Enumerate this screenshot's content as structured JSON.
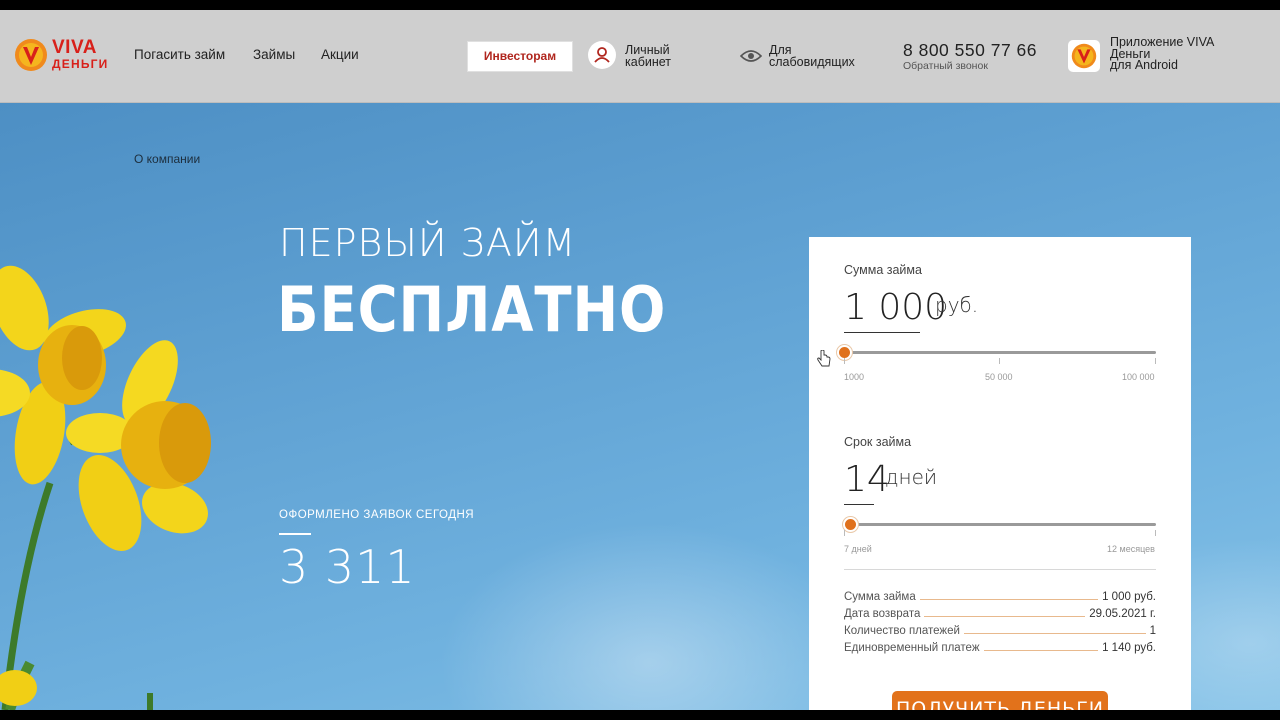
{
  "header": {
    "logo": {
      "brand_line1": "VIVA",
      "brand_line2": "ДЕНЬГИ"
    },
    "nav": [
      {
        "label": "Погасить займ"
      },
      {
        "label": "Займы"
      },
      {
        "label": "Акции"
      }
    ],
    "investors_button": "Инвесторам",
    "cabinet": {
      "line1": "Личный",
      "line2": "кабинет",
      "icon": "user-icon"
    },
    "accessibility": {
      "line1": "Для",
      "line2": "слабовидящих",
      "icon": "eye-icon"
    },
    "phone": "8 800 550 77 66",
    "callback": "Обратный звонок",
    "app_promo": {
      "line1": "Приложение VIVA",
      "line2": "Деньги",
      "line3": "для Android"
    }
  },
  "hero": {
    "breadcrumb": "О компании",
    "headline_line1": "ПЕРВЫЙ ЗАЙМ",
    "headline_line2": "БЕСПЛАТНО",
    "applications_label": "ОФОРМЛЕНО ЗАЯВОК СЕГОДНЯ",
    "applications_count": "3 311"
  },
  "calculator": {
    "amount": {
      "label": "Сумма займа",
      "value": "1 000",
      "unit": "руб.",
      "slider_fraction": 0,
      "ticks": [
        "1000",
        "50 000",
        "100 000"
      ]
    },
    "term": {
      "label": "Срок займа",
      "value": "14",
      "unit": "дней",
      "slider_fraction": 0.02,
      "ticks": [
        "7 дней",
        "12 месяцев"
      ]
    },
    "summary": [
      {
        "key": "Сумма займа",
        "value": "1 000 руб."
      },
      {
        "key": "Дата возврата",
        "value": "29.05.2021 г."
      },
      {
        "key": "Количество платежей",
        "value": "1"
      },
      {
        "key": "Единовременный платеж",
        "value": "1 140 руб."
      }
    ],
    "submit_button": "ПОЛУЧИТЬ ДЕНЬГИ"
  },
  "colors": {
    "accent": "#e2721b",
    "brand_red": "#d8201a",
    "header_bg": "#cfcfcf"
  }
}
